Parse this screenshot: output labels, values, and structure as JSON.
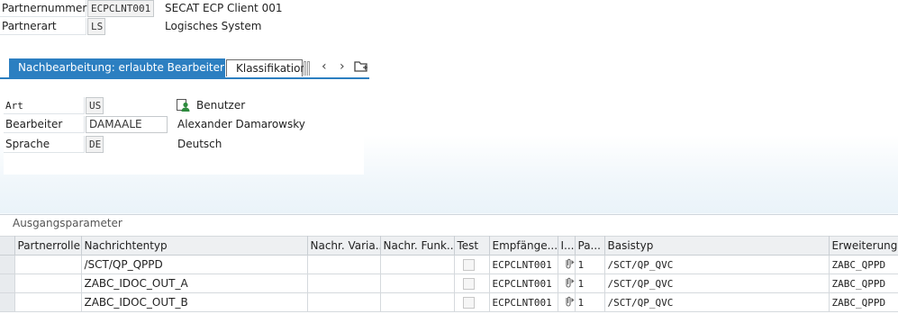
{
  "header": {
    "partnernummer_label": "Partnernummer",
    "partnernummer_value": "ECPCLNT001",
    "partnernummer_text": "SECAT ECP Client 001",
    "partnerart_label": "Partnerart",
    "partnerart_value": "LS",
    "partnerart_text": "Logisches System"
  },
  "tabs": {
    "active": "Nachbearbeitung: erlaubte Bearbeiter",
    "second": "Klassifikation",
    "prev_glyph": "‹",
    "next_glyph": "›"
  },
  "processor": {
    "art_label": "Art",
    "art_value": "US",
    "art_text": "Benutzer",
    "bearbeiter_label": "Bearbeiter",
    "bearbeiter_value": "DAMAALE",
    "bearbeiter_text": "Alexander Damarowsky",
    "sprache_label": "Sprache",
    "sprache_value": "DE",
    "sprache_text": "Deutsch"
  },
  "outbound": {
    "title": "Ausgangsparameter",
    "columns": [
      "Partnerrolle",
      "Nachrichtentyp",
      "Nachr. Varia...",
      "Nachr. Funk...",
      "Test",
      "Empfänge...",
      "I...",
      "Pa...",
      "Basistyp",
      "Erweiterung"
    ],
    "rows": [
      {
        "rolle": "",
        "nachrichtentyp": "/SCT/QP_QPPD",
        "variante": "",
        "funktion": "",
        "empfaenger": "ECPCLNT001",
        "paket": "1",
        "basistyp": "/SCT/QP_QVC",
        "erweiterung": "ZABC_QPPD"
      },
      {
        "rolle": "",
        "nachrichtentyp": "ZABC_IDOC_OUT_A",
        "variante": "",
        "funktion": "",
        "empfaenger": "ECPCLNT001",
        "paket": "1",
        "basistyp": "/SCT/QP_QVC",
        "erweiterung": "ZABC_QPPD"
      },
      {
        "rolle": "",
        "nachrichtentyp": "ZABC_IDOC_OUT_B",
        "variante": "",
        "funktion": "",
        "empfaenger": "ECPCLNT001",
        "paket": "1",
        "basistyp": "/SCT/QP_QVC",
        "erweiterung": "ZABC_QPPD"
      }
    ]
  },
  "icons": {
    "user": "user-icon",
    "clip": "paperclip-arrow-icon",
    "folder": "folder-icon"
  },
  "colors": {
    "accent": "#2c7fc1",
    "user_icon": "#2e8b3e"
  }
}
